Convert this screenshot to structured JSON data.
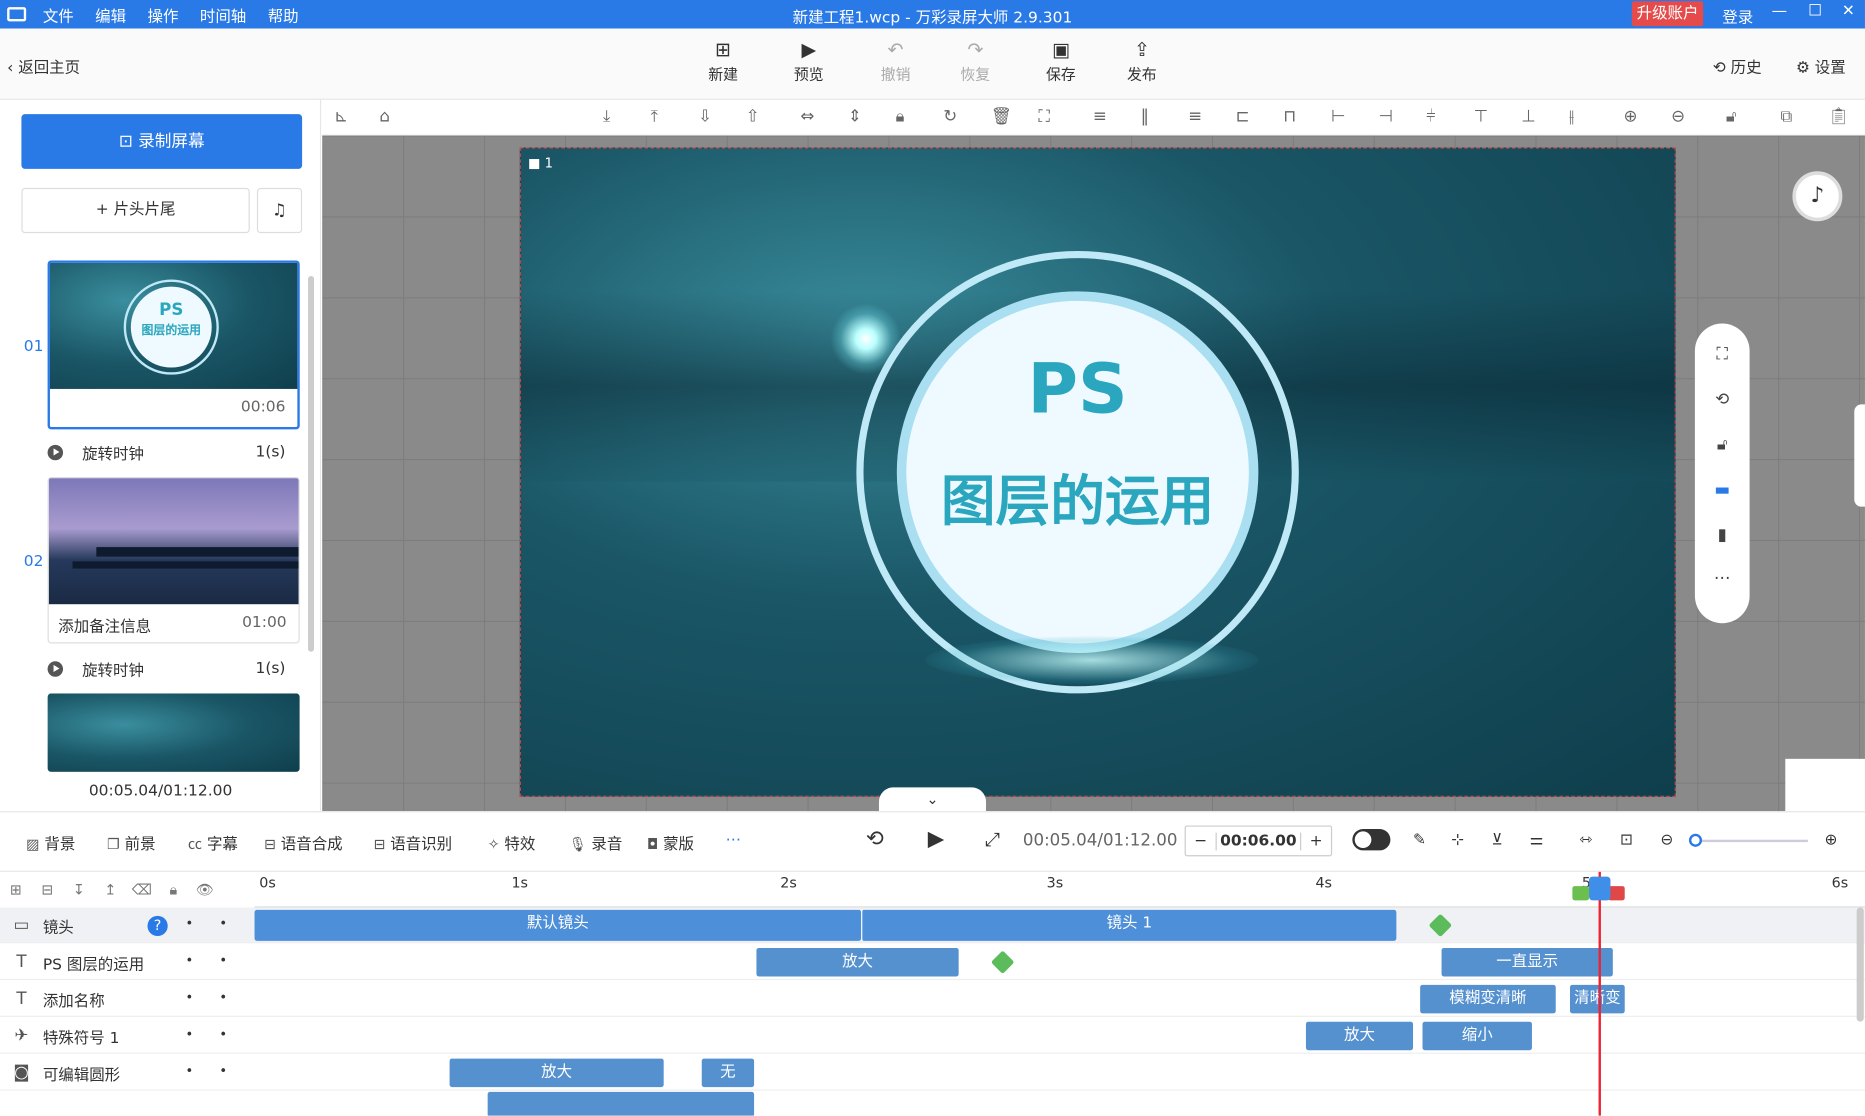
{
  "titlebar": {
    "menu": [
      "文件",
      "编辑",
      "操作",
      "时间轴",
      "帮助"
    ],
    "title": "新建工程1.wcp - 万彩录屏大师 2.9.301",
    "upgrade": "升级账户",
    "login": "登录"
  },
  "toolbar": {
    "back": "返回主页",
    "buttons": [
      {
        "label": "新建",
        "icon": "plus-box-icon"
      },
      {
        "label": "预览",
        "icon": "play-icon"
      },
      {
        "label": "撤销",
        "icon": "undo-icon"
      },
      {
        "label": "恢复",
        "icon": "redo-icon"
      },
      {
        "label": "保存",
        "icon": "save-icon"
      },
      {
        "label": "发布",
        "icon": "publish-icon"
      }
    ],
    "history": "历史",
    "settings": "设置"
  },
  "leftpanel": {
    "record": "录制屏幕",
    "headtail": "片头片尾",
    "scenes": [
      {
        "no": "01",
        "title": "PS",
        "subtitle": "图层的运用",
        "note": "",
        "duration": "00:06"
      },
      {
        "no": "02",
        "note": "添加备注信息",
        "duration": "01:00"
      }
    ],
    "transitions": [
      {
        "name": "旋转时钟",
        "duration": "1(s)"
      },
      {
        "name": "旋转时钟",
        "duration": "1(s)"
      }
    ],
    "total_time": "00:05.04/01:12.00"
  },
  "canvas": {
    "camera_no": "1",
    "title": "PS",
    "subtitle": "图层的运用"
  },
  "bottombar": {
    "tools": [
      "背景",
      "前景",
      "字幕",
      "语音合成",
      "语音识别",
      "特效",
      "录音",
      "蒙版"
    ],
    "current_time": "00:05.04/01:12.00",
    "duration": "00:06.00"
  },
  "timeline": {
    "ticks": [
      "0s",
      "1s",
      "2s",
      "3s",
      "4s",
      "5",
      "6s"
    ],
    "tracks": [
      {
        "name": "镜头",
        "icon": "camera-icon"
      },
      {
        "name": "PS 图层的运用",
        "icon": "text-icon"
      },
      {
        "name": "添加名称",
        "icon": "text-icon"
      },
      {
        "name": "特殊符号 1",
        "icon": "paper-plane-icon"
      },
      {
        "name": "可编辑圆形",
        "icon": "shape-icon"
      }
    ],
    "clips": {
      "cam_default": "默认镜头",
      "cam_1": "镜头 1",
      "t1_zoom": "放大",
      "t1_always": "一直显示",
      "t2_blur": "模糊变清晰",
      "t2_blur2": "清晰变",
      "t3_zoom": "放大",
      "t3_shrink": "缩小",
      "t4_zoom": "放大",
      "t4_none": "无"
    }
  }
}
